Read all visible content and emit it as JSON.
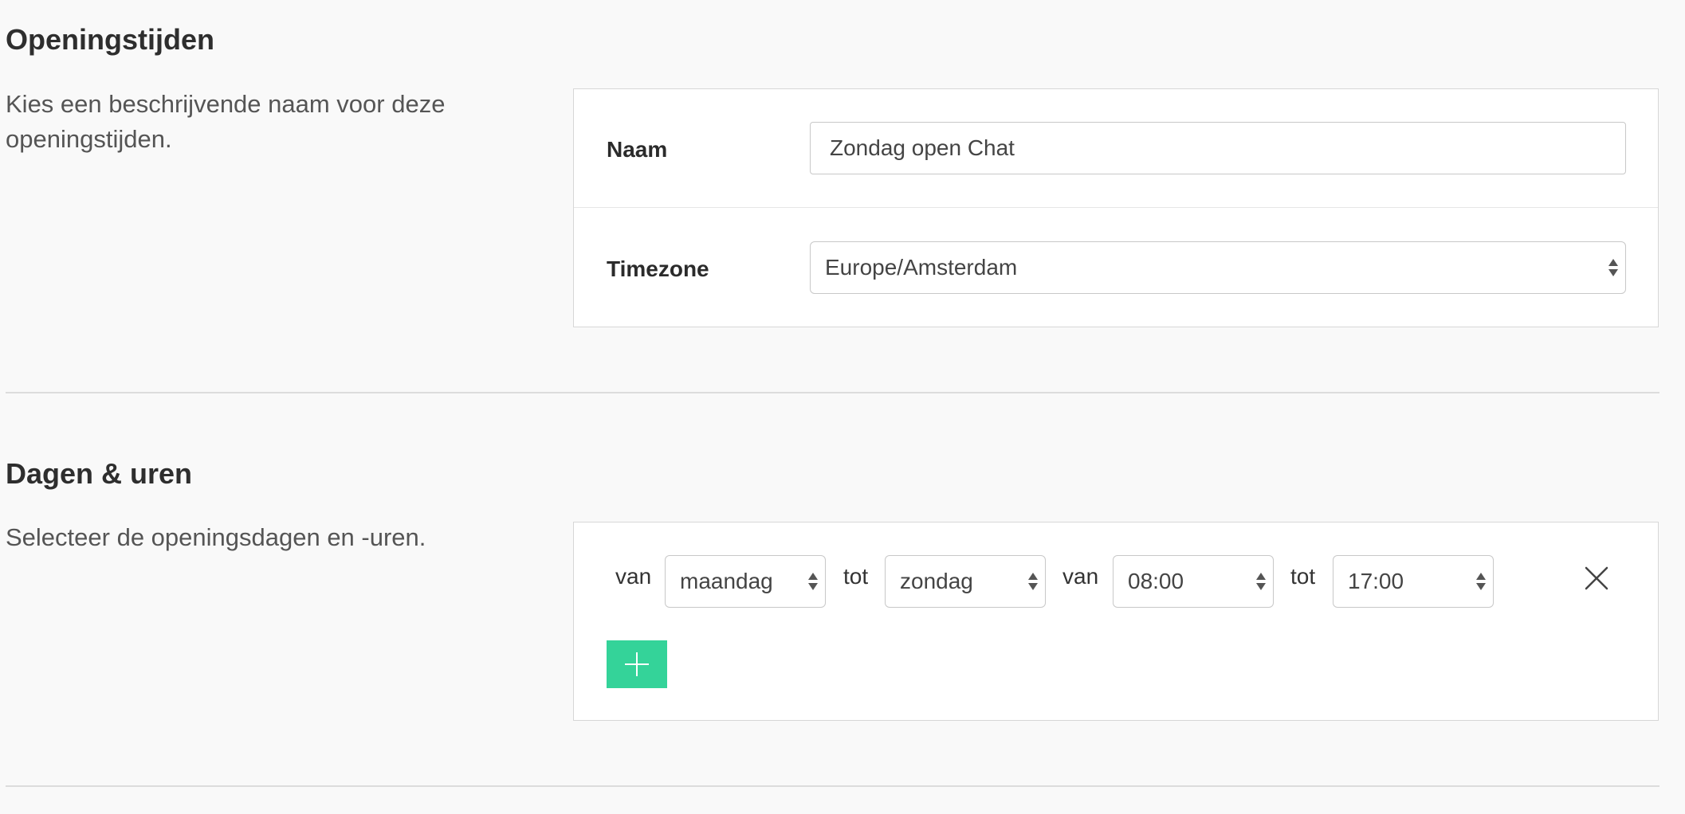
{
  "opening_hours_section": {
    "title": "Openingstijden",
    "description": "Kies een beschrijvende naam voor deze openingstijden.",
    "name_label": "Naam",
    "name_value": "Zondag open Chat",
    "timezone_label": "Timezone",
    "timezone_value": "Europe/Amsterdam"
  },
  "days_hours_section": {
    "title": "Dagen & uren",
    "description": "Selecteer de openingsdagen en -uren.",
    "rows": [
      {
        "from_label": "van",
        "from_day": "maandag",
        "to_label": "tot",
        "to_day": "zondag",
        "from_time_label": "van",
        "from_time": "08:00",
        "to_time_label": "tot",
        "to_time": "17:00"
      }
    ]
  },
  "icons": {
    "remove_row": "close-icon",
    "add_row": "plus-icon",
    "select": "updown-arrows-icon"
  },
  "colors": {
    "accent": "#34d399",
    "background": "#f9f9f9",
    "card_border": "#d7d7d7"
  }
}
